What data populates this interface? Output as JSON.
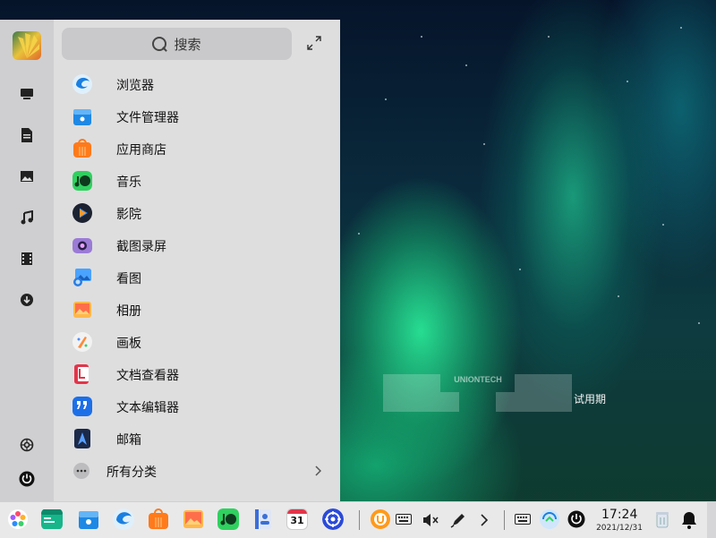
{
  "launcher": {
    "search_placeholder": "搜索",
    "apps": [
      {
        "label": "浏览器",
        "icon": "browser-icon"
      },
      {
        "label": "文件管理器",
        "icon": "file-manager-icon"
      },
      {
        "label": "应用商店",
        "icon": "app-store-icon"
      },
      {
        "label": "音乐",
        "icon": "music-icon"
      },
      {
        "label": "影院",
        "icon": "movie-icon"
      },
      {
        "label": "截图录屏",
        "icon": "screenshot-icon"
      },
      {
        "label": "看图",
        "icon": "image-viewer-icon"
      },
      {
        "label": "相册",
        "icon": "album-icon"
      },
      {
        "label": "画板",
        "icon": "draw-icon"
      },
      {
        "label": "文档查看器",
        "icon": "document-viewer-icon"
      },
      {
        "label": "文本编辑器",
        "icon": "text-editor-icon"
      },
      {
        "label": "邮箱",
        "icon": "mail-icon"
      }
    ],
    "all_categories": "所有分类"
  },
  "sidebar": {
    "items": [
      "avatar",
      "computer-icon",
      "documents-icon",
      "pictures-icon",
      "music-icon",
      "videos-icon",
      "downloads-icon",
      "settings-icon",
      "power-icon"
    ]
  },
  "desktop": {
    "watermark": "UNIONTECH",
    "trial_text": "试用期"
  },
  "taskbar": {
    "time": "17:24",
    "date": "2021/12/31",
    "calendar_day": "31"
  },
  "colors": {
    "launcher_bg": "#dededf",
    "sidebar_bg": "#cfcfd1",
    "taskbar_bg": "#e9e9ea"
  }
}
